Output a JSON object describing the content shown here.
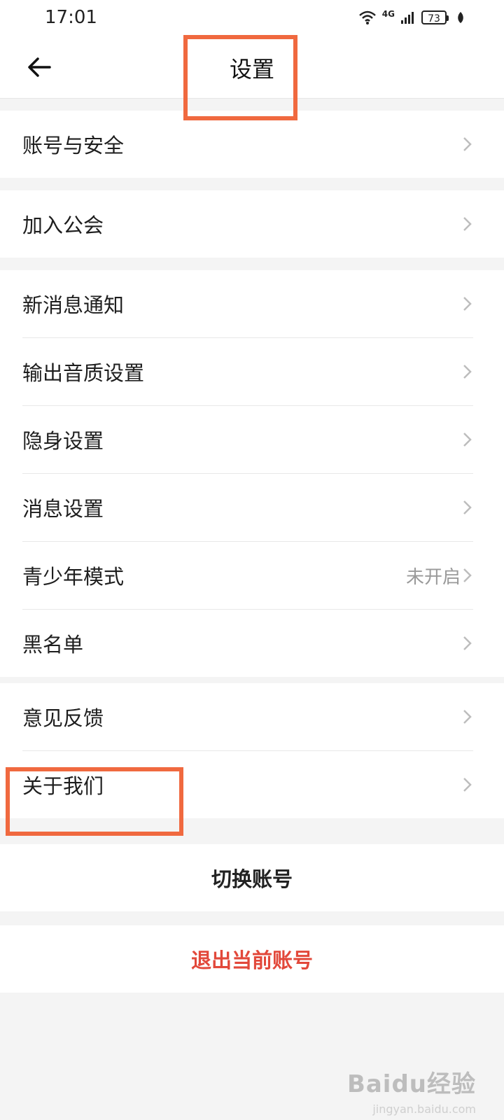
{
  "status_bar": {
    "time": "17:01",
    "network": "4G",
    "battery": "73"
  },
  "header": {
    "title": "设置"
  },
  "groups": [
    {
      "items": [
        {
          "label": "账号与安全"
        }
      ]
    },
    {
      "items": [
        {
          "label": "加入公会"
        }
      ]
    },
    {
      "items": [
        {
          "label": "新消息通知"
        },
        {
          "label": "输出音质设置"
        },
        {
          "label": "隐身设置"
        },
        {
          "label": "消息设置"
        },
        {
          "label": "青少年模式",
          "value": "未开启"
        },
        {
          "label": "黑名单"
        }
      ]
    },
    {
      "items": [
        {
          "label": "意见反馈"
        },
        {
          "label": "关于我们"
        }
      ]
    }
  ],
  "actions": {
    "switch_account": "切换账号",
    "logout": "退出当前账号"
  },
  "watermark": {
    "text": "Baidu经验",
    "sub": "jingyan.baidu.com"
  },
  "colors": {
    "highlight": "#f0693f",
    "logout": "#e2483a",
    "background": "#f4f4f4"
  }
}
